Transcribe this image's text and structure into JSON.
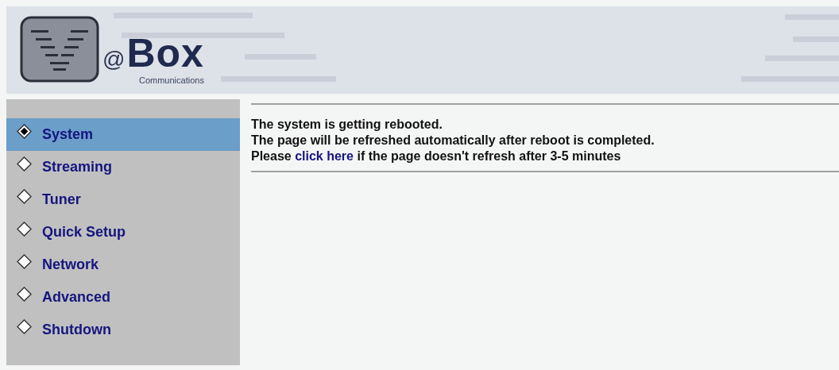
{
  "header": {
    "logo_symbol": "@",
    "logo_name": "Box",
    "logo_tagline": "Communications"
  },
  "sidebar": {
    "items": [
      {
        "label": "System",
        "selected": true
      },
      {
        "label": "Streaming",
        "selected": false
      },
      {
        "label": "Tuner",
        "selected": false
      },
      {
        "label": "Quick Setup",
        "selected": false
      },
      {
        "label": "Network",
        "selected": false
      },
      {
        "label": "Advanced",
        "selected": false
      },
      {
        "label": "Shutdown",
        "selected": false
      }
    ]
  },
  "message": {
    "lines": [
      "The system is getting rebooted.",
      "The page will be refreshed automatically after reboot is completed."
    ],
    "prompt_before": "Please",
    "link": "click here",
    "prompt_after": "if the page doesn't refresh after 3-5 minutes"
  }
}
